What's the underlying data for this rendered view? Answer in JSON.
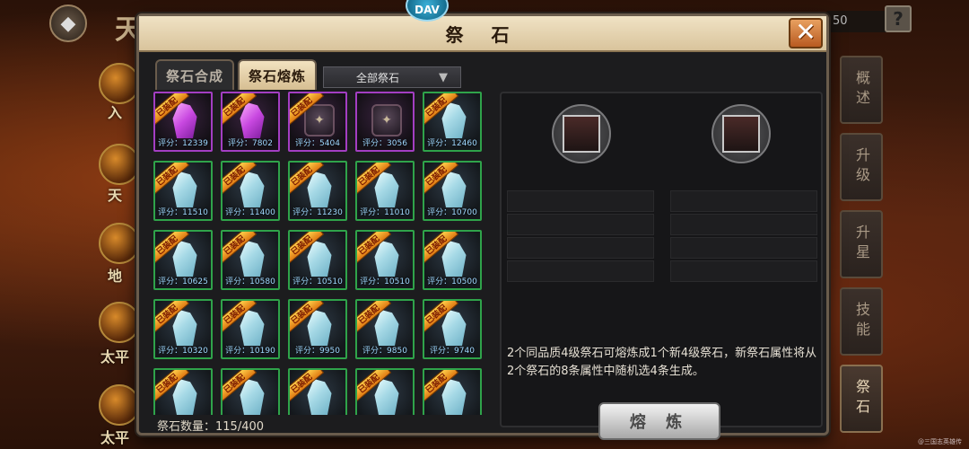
{
  "window": {
    "title": "祭 石",
    "close_icon": "close-x-icon"
  },
  "background": {
    "title_char": "天",
    "counter": "50",
    "help": "?",
    "logo_text": "DAV",
    "corner_text": "@三国志英雄传",
    "left_labels": [
      "入",
      "天",
      "地",
      "太平",
      "太平"
    ]
  },
  "tabs": [
    {
      "label": "祭石合成",
      "active": false
    },
    {
      "label": "祭石熔炼",
      "active": true
    }
  ],
  "filter": {
    "value": "全部祭石"
  },
  "side_nav": [
    {
      "label": "概述",
      "active": false
    },
    {
      "label": "升级",
      "active": false
    },
    {
      "label": "升星",
      "active": false
    },
    {
      "label": "技能",
      "active": false
    },
    {
      "label": "祭石",
      "active": true
    }
  ],
  "items": [
    {
      "badge": "已装配",
      "score": "评分：12339",
      "quality": "purple",
      "kind": "crystal"
    },
    {
      "badge": "已装配",
      "score": "评分：7802",
      "quality": "purple",
      "kind": "crystal"
    },
    {
      "badge": "已装配",
      "score": "评分：5404",
      "quality": "purple",
      "kind": "lock"
    },
    {
      "badge": "",
      "score": "评分：3056",
      "quality": "purple",
      "kind": "lock"
    },
    {
      "badge": "已装配",
      "score": "评分：12460",
      "quality": "green",
      "kind": "crystal"
    },
    {
      "badge": "已装配",
      "score": "评分：11510",
      "quality": "green",
      "kind": "crystal"
    },
    {
      "badge": "已装配",
      "score": "评分：11400",
      "quality": "green",
      "kind": "crystal"
    },
    {
      "badge": "已装配",
      "score": "评分：11230",
      "quality": "green",
      "kind": "crystal"
    },
    {
      "badge": "已装配",
      "score": "评分：11010",
      "quality": "green",
      "kind": "crystal"
    },
    {
      "badge": "已装配",
      "score": "评分：10700",
      "quality": "green",
      "kind": "crystal"
    },
    {
      "badge": "已装配",
      "score": "评分：10625",
      "quality": "green",
      "kind": "crystal"
    },
    {
      "badge": "已装配",
      "score": "评分：10580",
      "quality": "green",
      "kind": "crystal"
    },
    {
      "badge": "已装配",
      "score": "评分：10510",
      "quality": "green",
      "kind": "crystal"
    },
    {
      "badge": "已装配",
      "score": "评分：10510",
      "quality": "green",
      "kind": "crystal"
    },
    {
      "badge": "已装配",
      "score": "评分：10500",
      "quality": "green",
      "kind": "crystal"
    },
    {
      "badge": "已装配",
      "score": "评分：10320",
      "quality": "green",
      "kind": "crystal"
    },
    {
      "badge": "已装配",
      "score": "评分：10190",
      "quality": "green",
      "kind": "crystal"
    },
    {
      "badge": "已装配",
      "score": "评分：9950",
      "quality": "green",
      "kind": "crystal"
    },
    {
      "badge": "已装配",
      "score": "评分：9850",
      "quality": "green",
      "kind": "crystal"
    },
    {
      "badge": "已装配",
      "score": "评分：9740",
      "quality": "green",
      "kind": "crystal"
    },
    {
      "badge": "已装配",
      "score": "",
      "quality": "green",
      "kind": "crystal"
    },
    {
      "badge": "已装配",
      "score": "",
      "quality": "green",
      "kind": "crystal"
    },
    {
      "badge": "已装配",
      "score": "",
      "quality": "green",
      "kind": "crystal"
    },
    {
      "badge": "已装配",
      "score": "",
      "quality": "green",
      "kind": "crystal"
    },
    {
      "badge": "已装配",
      "score": "",
      "quality": "green",
      "kind": "crystal"
    }
  ],
  "count_label": "祭石数量：115/400",
  "fusion": {
    "description": "2个同品质4级祭石可熔炼成1个新4级祭石，新祭石属性将从2个祭石的8条属性中随机选4条生成。",
    "button_label": "熔 炼"
  },
  "colors": {
    "green_border": "#2fa34a",
    "purple_border": "#a33ec2",
    "title_bar": "#e6d4b0"
  }
}
